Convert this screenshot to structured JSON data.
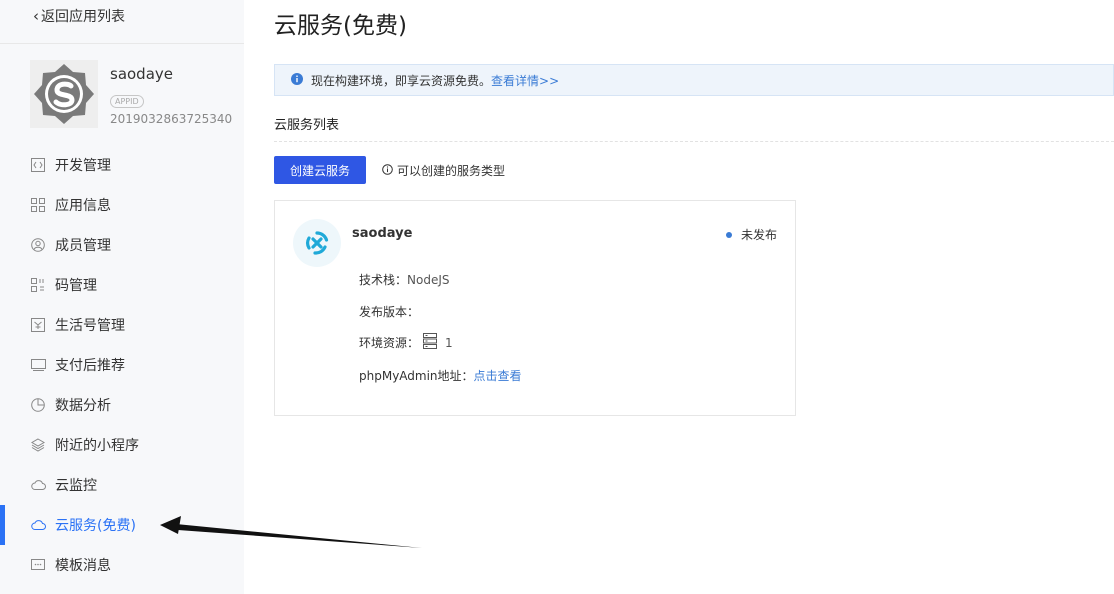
{
  "sidebar": {
    "back_label": "返回应用列表",
    "app": {
      "name": "saodaye",
      "appid_badge": "APPID",
      "appid": "2019032863725340"
    },
    "items": [
      {
        "label": "开发管理",
        "icon": "code-icon"
      },
      {
        "label": "应用信息",
        "icon": "grid-icon"
      },
      {
        "label": "成员管理",
        "icon": "user-icon"
      },
      {
        "label": "码管理",
        "icon": "qrcode-icon"
      },
      {
        "label": "生活号管理",
        "icon": "life-account-icon"
      },
      {
        "label": "支付后推荐",
        "icon": "monitor-icon"
      },
      {
        "label": "数据分析",
        "icon": "pie-chart-icon"
      },
      {
        "label": "附近的小程序",
        "icon": "nearby-icon"
      },
      {
        "label": "云监控",
        "icon": "cloud-icon"
      },
      {
        "label": "云服务(免费)",
        "icon": "cloud-icon",
        "active": true
      },
      {
        "label": "模板消息",
        "icon": "message-icon"
      }
    ]
  },
  "main": {
    "title": "云服务(免费)",
    "notice": {
      "text": "现在构建环境，即享云资源免费。",
      "link": "查看详情>>"
    },
    "section_title": "云服务列表",
    "create_button": "创建云服务",
    "service_types_link": "可以创建的服务类型",
    "service": {
      "name": "saodaye",
      "status": "未发布",
      "tech_stack_label": "技术栈：",
      "tech_stack_value": "NodeJS",
      "release_version_label": "发布版本：",
      "env_resources_label": "环境资源：",
      "env_resources_value": "1",
      "phpmyadmin_label": "phpMyAdmin地址：",
      "phpmyadmin_link": "点击查看"
    }
  },
  "colors": {
    "accent": "#2b72f5",
    "button": "#2f57e4",
    "link": "#3a7bd5",
    "sidebar_bg": "#f7f8fa",
    "notice_bg": "#eef4fb"
  }
}
